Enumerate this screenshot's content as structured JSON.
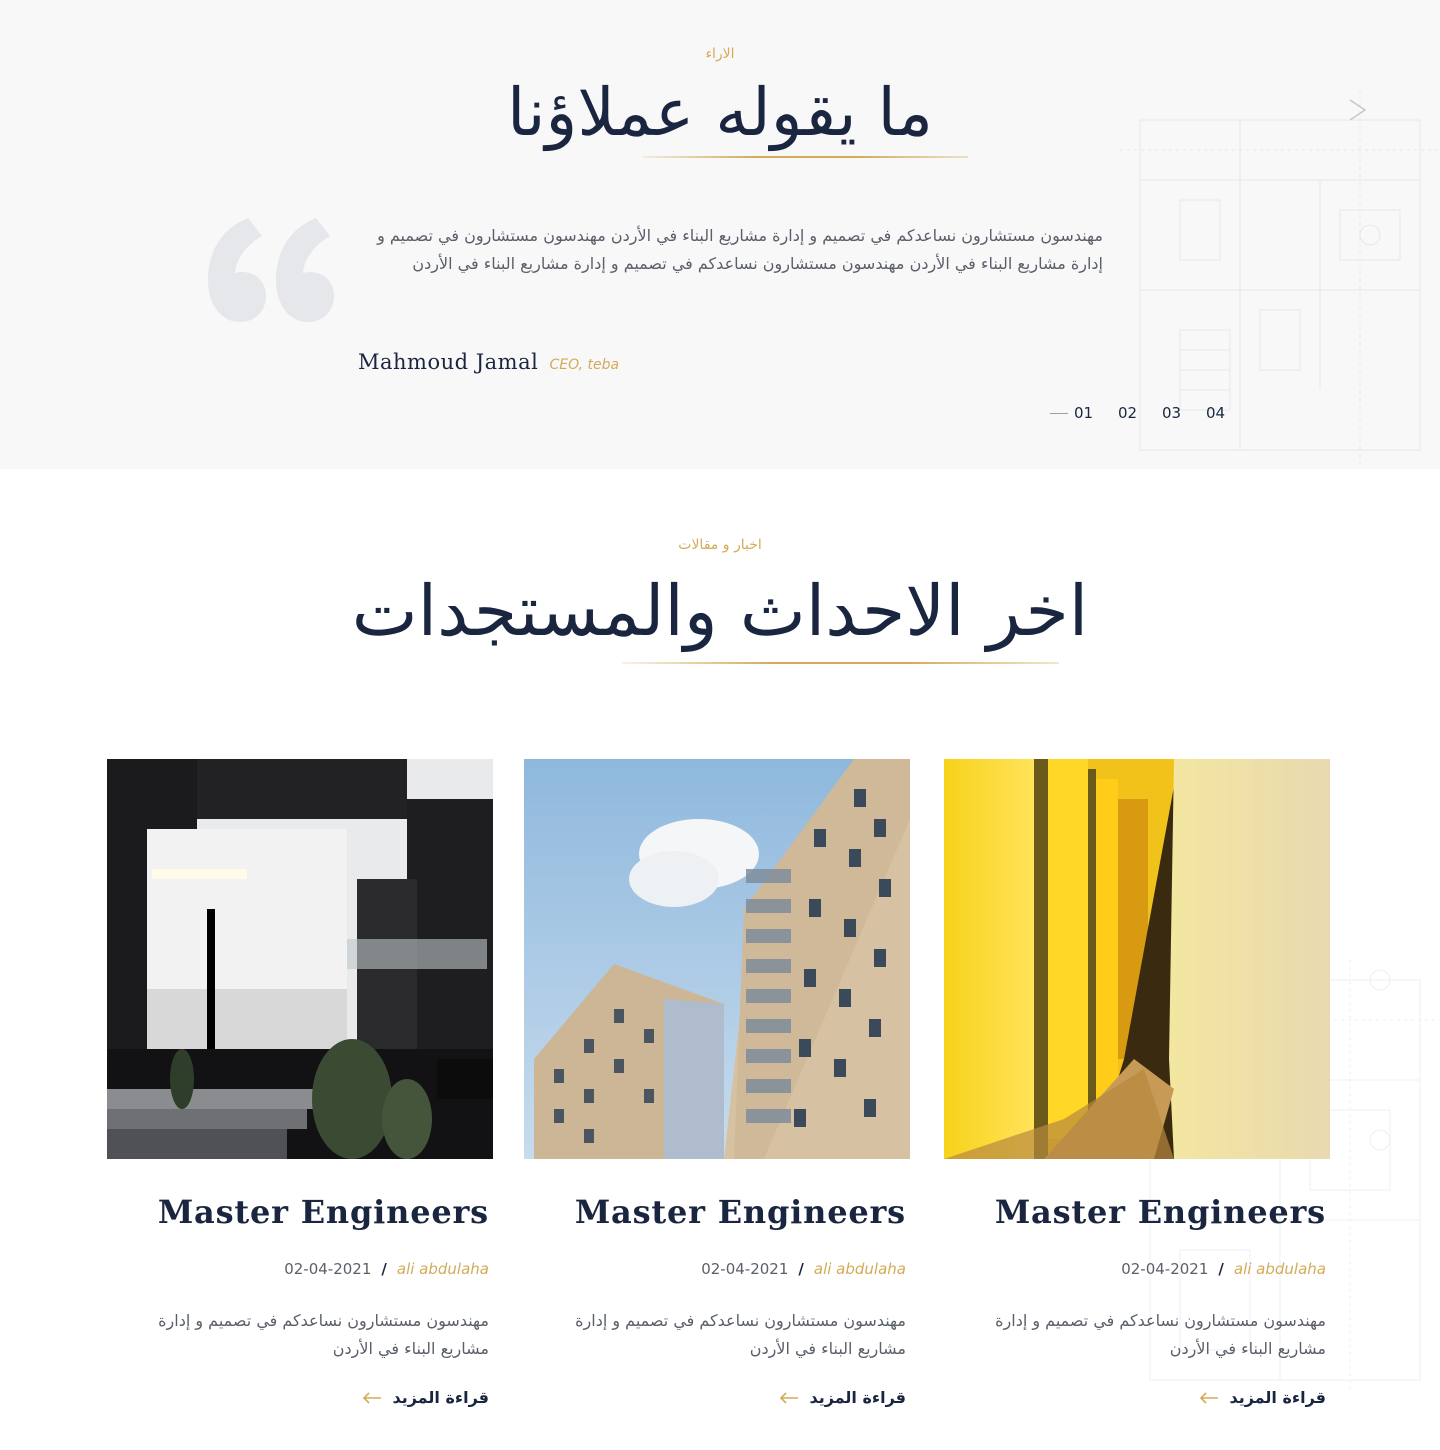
{
  "testimonials": {
    "eyebrow": "الاراء",
    "title": "ما يقوله عملاؤنا",
    "quote": "مهندسون مستشارون نساعدكم في تصميم و إدارة مشاريع البناء في الأردن مهندسون مستشارون  في تصميم و إدارة مشاريع البناء في الأردن مهندسون مستشارون نساعدكم في تصميم و إدارة مشاريع البناء في الأردن",
    "author_name": "Mahmoud Jamal",
    "author_role": "CEO, teba",
    "pager": [
      "01",
      "02",
      "03",
      "04"
    ],
    "active_page": "01"
  },
  "news": {
    "eyebrow": "اخبار و مقالات",
    "title": "اخر الاحداث والمستجدات",
    "cards": [
      {
        "image": "modern-black-white-villa-night",
        "title": "Master Engineers",
        "date": "02-04-2021",
        "separator": "/",
        "author": "ali abdulaha",
        "excerpt": "مهندسون مستشارون نساعدكم في تصميم و إدارة مشاريع البناء في الأردن",
        "read_more": "قراءة المزيد"
      },
      {
        "image": "beige-apartment-tower-blue-sky",
        "title": "Master Engineers",
        "date": "02-04-2021",
        "separator": "/",
        "author": "ali abdulaha",
        "excerpt": "مهندسون مستشارون نساعدكم في تصميم و إدارة مشاريع البناء في الأردن",
        "read_more": "قراءة المزيد"
      },
      {
        "image": "yellow-lit-curved-corridor",
        "title": "Master Engineers",
        "date": "02-04-2021",
        "separator": "/",
        "author": "ali abdulaha",
        "excerpt": "مهندسون مستشارون نساعدكم في تصميم و إدارة مشاريع البناء في الأردن",
        "read_more": "قراءة المزيد"
      }
    ]
  },
  "colors": {
    "navy": "#1a2640",
    "gold": "#d3ab58",
    "body_text": "#5a5f6a",
    "section_bg": "#f8f8f8"
  },
  "icons": [
    "quote-icon",
    "arrow-left-icon",
    "blueprint-decoration"
  ]
}
